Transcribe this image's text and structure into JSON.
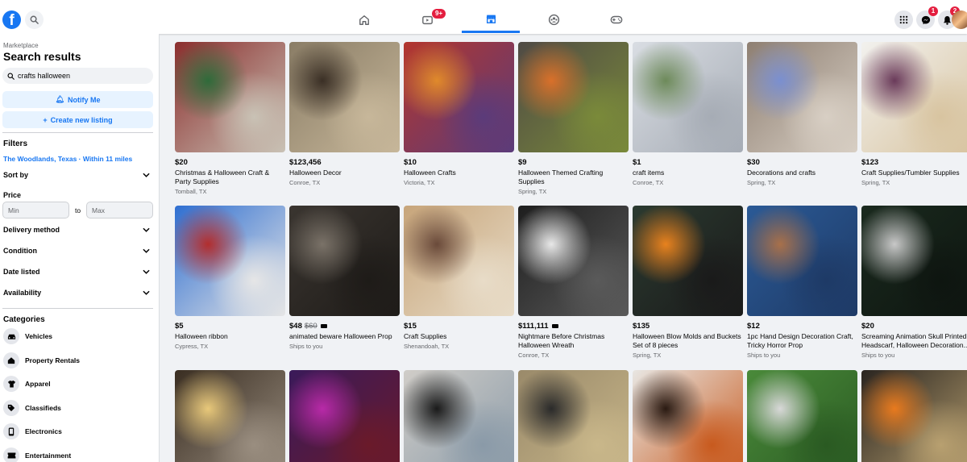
{
  "topbar": {
    "logo": "f",
    "nav": [
      {
        "icon": "home-icon",
        "badge": ""
      },
      {
        "icon": "video-icon",
        "badge": "9+"
      },
      {
        "icon": "marketplace-icon",
        "badge": ""
      },
      {
        "icon": "groups-icon",
        "badge": ""
      },
      {
        "icon": "gaming-icon",
        "badge": ""
      }
    ],
    "messenger_badge": "1",
    "notifications_badge": "2"
  },
  "sidebar": {
    "section": "Marketplace",
    "title": "Search results",
    "search_value": "crafts halloween",
    "notify_label": "Notify Me",
    "create_label": "Create new listing",
    "filters_heading": "Filters",
    "location": "The Woodlands, Texas · Within 11 miles",
    "sort_by": "Sort by",
    "price_heading": "Price",
    "price_min_placeholder": "Min",
    "price_to": "to",
    "price_max_placeholder": "Max",
    "delivery": "Delivery method",
    "condition": "Condition",
    "date_listed": "Date listed",
    "availability": "Availability",
    "categories_heading": "Categories",
    "categories": [
      {
        "label": "Vehicles",
        "icon": "car-icon"
      },
      {
        "label": "Property Rentals",
        "icon": "house-icon"
      },
      {
        "label": "Apparel",
        "icon": "shirt-icon"
      },
      {
        "label": "Classifieds",
        "icon": "tag-icon"
      },
      {
        "label": "Electronics",
        "icon": "phone-icon"
      },
      {
        "label": "Entertainment",
        "icon": "ticket-icon"
      }
    ]
  },
  "listings": [
    {
      "price": "$20",
      "old": "",
      "video": false,
      "title": "Christmas & Halloween Craft & Party Supplies",
      "location": "Tomball, TX",
      "colors": [
        "#8b2e2e",
        "#2f6b3a",
        "#c9c2b5"
      ]
    },
    {
      "price": "$123,456",
      "old": "",
      "video": false,
      "title": "Halloween Decor",
      "location": "Conroe, TX",
      "colors": [
        "#8a7d66",
        "#3a2f25",
        "#c7b79a"
      ]
    },
    {
      "price": "$10",
      "old": "",
      "video": false,
      "title": "Halloween Crafts",
      "location": "Victoria, TX",
      "colors": [
        "#b3362e",
        "#e08a2b",
        "#5b3b7a"
      ]
    },
    {
      "price": "$9",
      "old": "",
      "video": false,
      "title": "Halloween Themed Crafting Supplies",
      "location": "Spring, TX",
      "colors": [
        "#4f4a45",
        "#d9702a",
        "#7a8a3a"
      ]
    },
    {
      "price": "$1",
      "old": "",
      "video": false,
      "title": "craft items",
      "location": "Conroe, TX",
      "colors": [
        "#d9dde3",
        "#6d8a5a",
        "#a6acb5"
      ]
    },
    {
      "price": "$30",
      "old": "",
      "video": false,
      "title": "Decorations and crafts",
      "location": "Spring, TX",
      "colors": [
        "#8e7f72",
        "#7a8fd0",
        "#d8cfc4"
      ]
    },
    {
      "price": "$123",
      "old": "",
      "video": false,
      "title": "Craft Supplies/Tumbler Supplies",
      "location": "Spring, TX",
      "colors": [
        "#f2f1ee",
        "#6a3a5a",
        "#d8c4a0"
      ]
    },
    {
      "price": "$5",
      "old": "",
      "video": false,
      "title": "Halloween ribbon",
      "location": "Cypress, TX",
      "colors": [
        "#2f6fd1",
        "#b22e2e",
        "#e6e6e6"
      ]
    },
    {
      "price": "$48",
      "old": "$60",
      "video": true,
      "title": "animated beware Halloween Prop",
      "location": "Ships to you",
      "colors": [
        "#3a3530",
        "#7a7268",
        "#1e1b18"
      ]
    },
    {
      "price": "$15",
      "old": "",
      "video": false,
      "title": "Craft Supplies",
      "location": "Shenandoah, TX",
      "colors": [
        "#c7a57a",
        "#6a4a3a",
        "#e8dcc8"
      ]
    },
    {
      "price": "$111,111",
      "old": "",
      "video": true,
      "title": "Nightmare Before Christmas Halloween Wreath",
      "location": "Conroe, TX",
      "colors": [
        "#1e1e1e",
        "#e8e8e8",
        "#5a5a5a"
      ]
    },
    {
      "price": "$135",
      "old": "",
      "video": false,
      "title": "Halloween Blow Molds and Buckets Set of 8 pieces",
      "location": "Spring, TX",
      "colors": [
        "#2b3a30",
        "#e8821e",
        "#1a1a1a"
      ]
    },
    {
      "price": "$12",
      "old": "",
      "video": false,
      "title": "1pc Hand Design Decoration Craft, Tricky Horror Prop",
      "location": "Ships to you",
      "colors": [
        "#2b5a96",
        "#a8704a",
        "#1e3a66"
      ]
    },
    {
      "price": "$20",
      "old": "",
      "video": false,
      "title": "Screaming Animation Skull Printed Headscarf, Halloween Decoration...",
      "location": "Ships to you",
      "colors": [
        "#1a2a1e",
        "#c8c8c8",
        "#0e1510"
      ]
    },
    {
      "price": "",
      "old": "",
      "video": false,
      "title": "",
      "location": "",
      "colors": [
        "#3a2e22",
        "#e8c87a",
        "#9a8e80"
      ]
    },
    {
      "price": "",
      "old": "",
      "video": false,
      "title": "",
      "location": "",
      "colors": [
        "#3a1a5a",
        "#b82aa8",
        "#6a1a2a"
      ]
    },
    {
      "price": "",
      "old": "",
      "video": false,
      "title": "",
      "location": "",
      "colors": [
        "#d0cdc8",
        "#1a1a1a",
        "#8a9aa8"
      ]
    },
    {
      "price": "",
      "old": "",
      "video": false,
      "title": "",
      "location": "",
      "colors": [
        "#9a8a6a",
        "#2a2a2a",
        "#c9b78a"
      ]
    },
    {
      "price": "",
      "old": "",
      "video": false,
      "title": "",
      "location": "",
      "colors": [
        "#e8e6e2",
        "#2a1a12",
        "#c85a1e"
      ]
    },
    {
      "price": "",
      "old": "",
      "video": false,
      "title": "",
      "location": "",
      "colors": [
        "#4a8a3a",
        "#d8d8d8",
        "#2a5a22"
      ]
    },
    {
      "price": "",
      "old": "",
      "video": false,
      "title": "",
      "location": "",
      "colors": [
        "#2a2520",
        "#e87a1e",
        "#b8a070"
      ]
    }
  ],
  "accent": "#1877f2"
}
